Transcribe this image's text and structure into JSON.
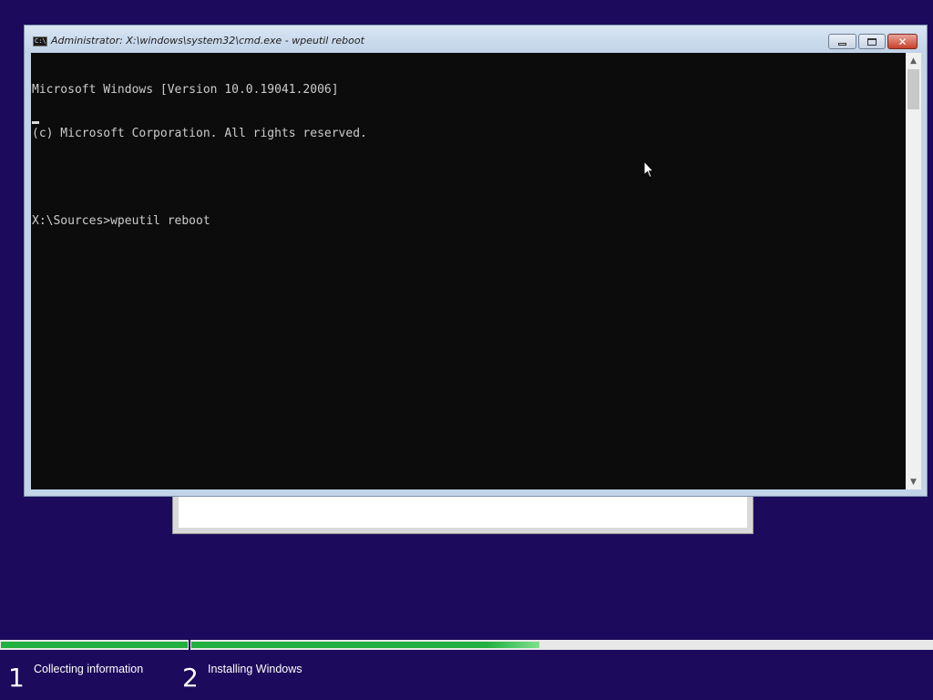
{
  "window": {
    "title": "Administrator: X:\\windows\\system32\\cmd.exe - wpeutil  reboot",
    "app_icon": "cmd-icon",
    "app_icon_text": "C:\\",
    "buttons": {
      "minimize": "minimize-icon",
      "restore": "restore-icon",
      "close": "close-icon",
      "close_glyph": "✕"
    }
  },
  "console": {
    "lines": [
      "Microsoft Windows [Version 10.0.19041.2006]",
      "(c) Microsoft Corporation. All rights reserved.",
      "",
      "X:\\Sources>wpeutil reboot"
    ],
    "background": "#0c0c0c",
    "foreground": "#cccccc",
    "scroll_up_glyph": "▲",
    "scroll_down_glyph": "▼"
  },
  "setup_progress": {
    "steps": [
      {
        "number": "1",
        "label": "Collecting information",
        "progress": 1.0
      },
      {
        "number": "2",
        "label": "Installing Windows",
        "progress": 0.47
      }
    ],
    "accent_color": "#22b040",
    "background_color": "#1c0a5c"
  }
}
